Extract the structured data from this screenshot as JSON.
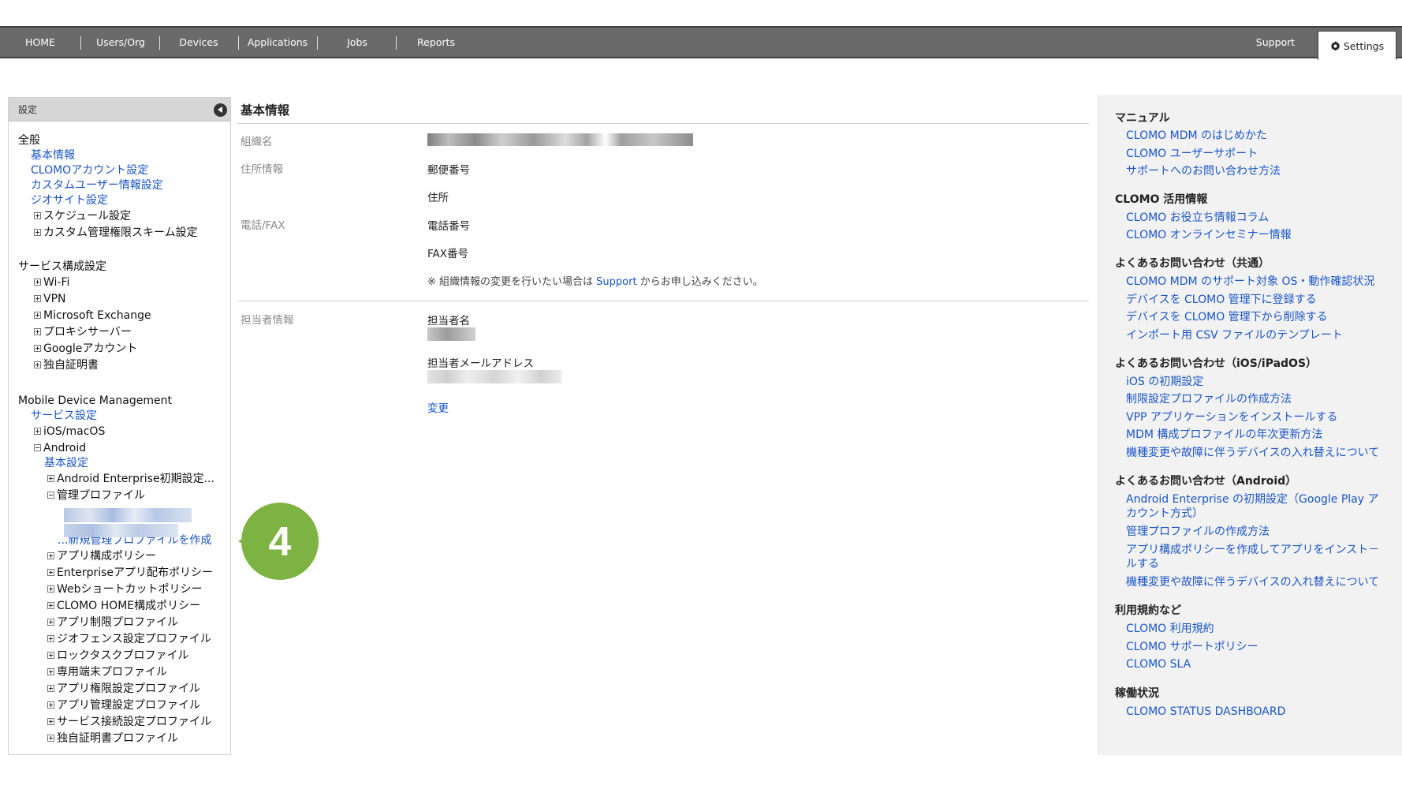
{
  "topnav": {
    "items": [
      "HOME",
      "Users/Org",
      "Devices",
      "Applications",
      "Jobs",
      "Reports"
    ],
    "support": "Support",
    "settings": "Settings"
  },
  "sidebar": {
    "header": "設定",
    "general": {
      "title": "全般",
      "links": [
        "基本情報",
        "CLOMOアカウント設定",
        "カスタムユーザー情報設定",
        "ジオサイト設定"
      ],
      "expandables": [
        "スケジュール設定",
        "カスタム管理権限スキーム設定"
      ]
    },
    "service": {
      "title": "サービス構成設定",
      "items": [
        "Wi-Fi",
        "VPN",
        "Microsoft Exchange",
        "プロキシサーバー",
        "Googleアカウント",
        "独自証明書"
      ]
    },
    "mdm": {
      "title": "Mobile Device Management",
      "service_link": "サービス設定",
      "ios": "iOS/macOS",
      "android": "Android",
      "android_basic": "基本設定",
      "android_enterprise": "Android Enterprise初期設定...",
      "managed_profile": "管理プロファイル",
      "new_profile": "...新規管理プロファイルを作成",
      "android_items": [
        "アプリ構成ポリシー",
        "Enterpriseアプリ配布ポリシー",
        "Webショートカットポリシー",
        "CLOMO HOME構成ポリシー",
        "アプリ制限プロファイル",
        "ジオフェンス設定プロファイル",
        "ロックタスクプロファイル",
        "専用端末プロファイル",
        "アプリ権限設定プロファイル",
        "アプリ管理設定プロファイル",
        "サービス接続設定プロファイル",
        "独自証明書プロファイル"
      ]
    }
  },
  "main": {
    "title": "基本情報",
    "org_label": "組織名",
    "address_label": "住所情報",
    "postal": "郵便番号",
    "address": "住所",
    "phone_label": "電話/FAX",
    "phone": "電話番号",
    "fax": "FAX番号",
    "note_prefix": "※ 組織情報の変更を行いたい場合は",
    "note_link": "Support",
    "note_suffix": "からお申し込みください。",
    "contact_label": "担当者情報",
    "contact_name": "担当者名",
    "contact_email": "担当者メールアドレス",
    "change": "変更"
  },
  "right": {
    "manual": {
      "title": "マニュアル",
      "links": [
        "CLOMO MDM のはじめかた",
        "CLOMO ユーザーサポート",
        "サポートへのお問い合わせ方法"
      ]
    },
    "usage": {
      "title": "CLOMO 活用情報",
      "links": [
        "CLOMO お役立ち情報コラム",
        "CLOMO オンラインセミナー情報"
      ]
    },
    "faq_common": {
      "title": "よくあるお問い合わせ（共通）",
      "links": [
        "CLOMO MDM のサポート対象 OS・動作確認状況",
        "デバイスを CLOMO 管理下に登録する",
        "デバイスを CLOMO 管理下から削除する",
        "インポート用 CSV ファイルのテンプレート"
      ]
    },
    "faq_ios": {
      "title": "よくあるお問い合わせ（iOS/iPadOS）",
      "links": [
        "iOS の初期設定",
        "制限設定プロファイルの作成方法",
        "VPP アプリケーションをインストールする",
        "MDM 構成プロファイルの年次更新方法",
        "機種変更や故障に伴うデバイスの入れ替えについて"
      ]
    },
    "faq_android": {
      "title": "よくあるお問い合わせ（Android）",
      "link1_line1": "Android Enterprise の初期設定（Google Play ア",
      "link1_line2": "カウント方式）",
      "link2": "管理プロファイルの作成方法",
      "link3_line1": "アプリ構成ポリシーを作成してアプリをインスト－",
      "link3_line2": "ルする",
      "link4": "機種変更や故障に伴うデバイスの入れ替えについて"
    },
    "terms": {
      "title": "利用規約など",
      "links": [
        "CLOMO 利用規約",
        "CLOMO サポートポリシー",
        "CLOMO SLA"
      ]
    },
    "status": {
      "title": "稼働状況",
      "links": [
        "CLOMO STATUS DASHBOARD"
      ]
    }
  },
  "callout": {
    "number": "4",
    "color": "#7cb342"
  }
}
